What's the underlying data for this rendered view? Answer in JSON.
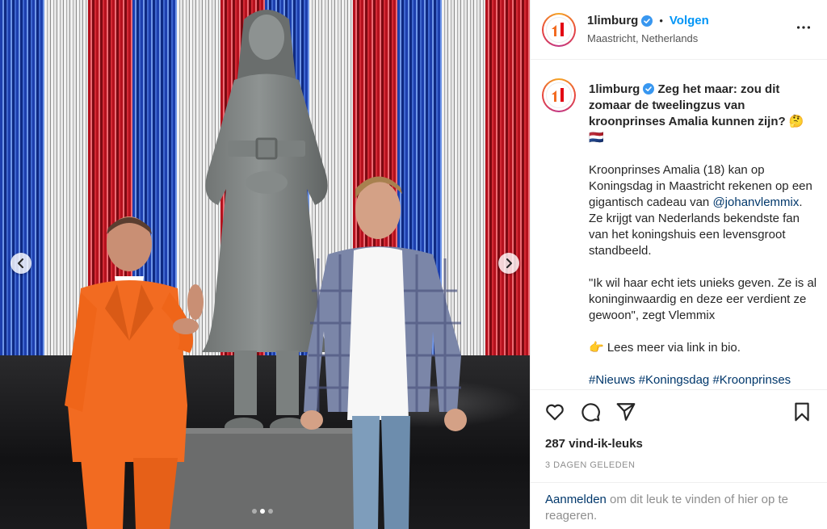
{
  "post": {
    "username": "1limburg",
    "follow_label": "Volgen",
    "separator": "•",
    "location": "Maastricht, Netherlands",
    "image_alt": "Statue of a woman between two men in front of a red, white and blue tinsel curtain",
    "carousel": {
      "count": 3,
      "active_index": 1
    }
  },
  "caption": {
    "username": "1limburg",
    "lead": "Zeg het maar: zou dit zomaar de tweelingzus van kroonprinses Amalia kunnen zijn? 🤔🇳🇱",
    "para1_before": "Kroonprinses Amalia (18) kan op Koningsdag in Maastricht rekenen op een gigantisch cadeau van ",
    "mention": "@johanvlemmix",
    "para1_after": ". Ze krijgt van Nederlands bekendste fan van het koningshuis een levensgroot standbeeld.",
    "para2": "\"Ik wil haar echt iets unieks geven. Ze is al koninginwaardig en deze eer verdient ze gewoon\", zegt Vlemmix",
    "para3": "👉 Lees meer via link in bio.",
    "hashtags": [
      "#Nieuws",
      "#Koningsdag",
      "#Kroonprinses"
    ]
  },
  "stats": {
    "likes": "287 vind-ik-leuks",
    "time": "3 DAGEN GELEDEN"
  },
  "login": {
    "link": "Aanmelden",
    "rest": " om dit leuk te vinden of hier op te reageren."
  },
  "icons": {
    "like": "heart-icon",
    "comment": "comment-icon",
    "share": "paper-plane-icon",
    "save": "bookmark-icon",
    "more": "more-horizontal-icon",
    "verified": "verified-badge-icon",
    "prev": "chevron-left-icon",
    "next": "chevron-right-icon"
  },
  "colors": {
    "accent": "#0095f6",
    "link": "#00376b",
    "text": "#262626",
    "muted": "#8e8e8e",
    "verified": "#3897f0",
    "brand_orange": "#f26b21",
    "brand_red": "#e30613"
  }
}
